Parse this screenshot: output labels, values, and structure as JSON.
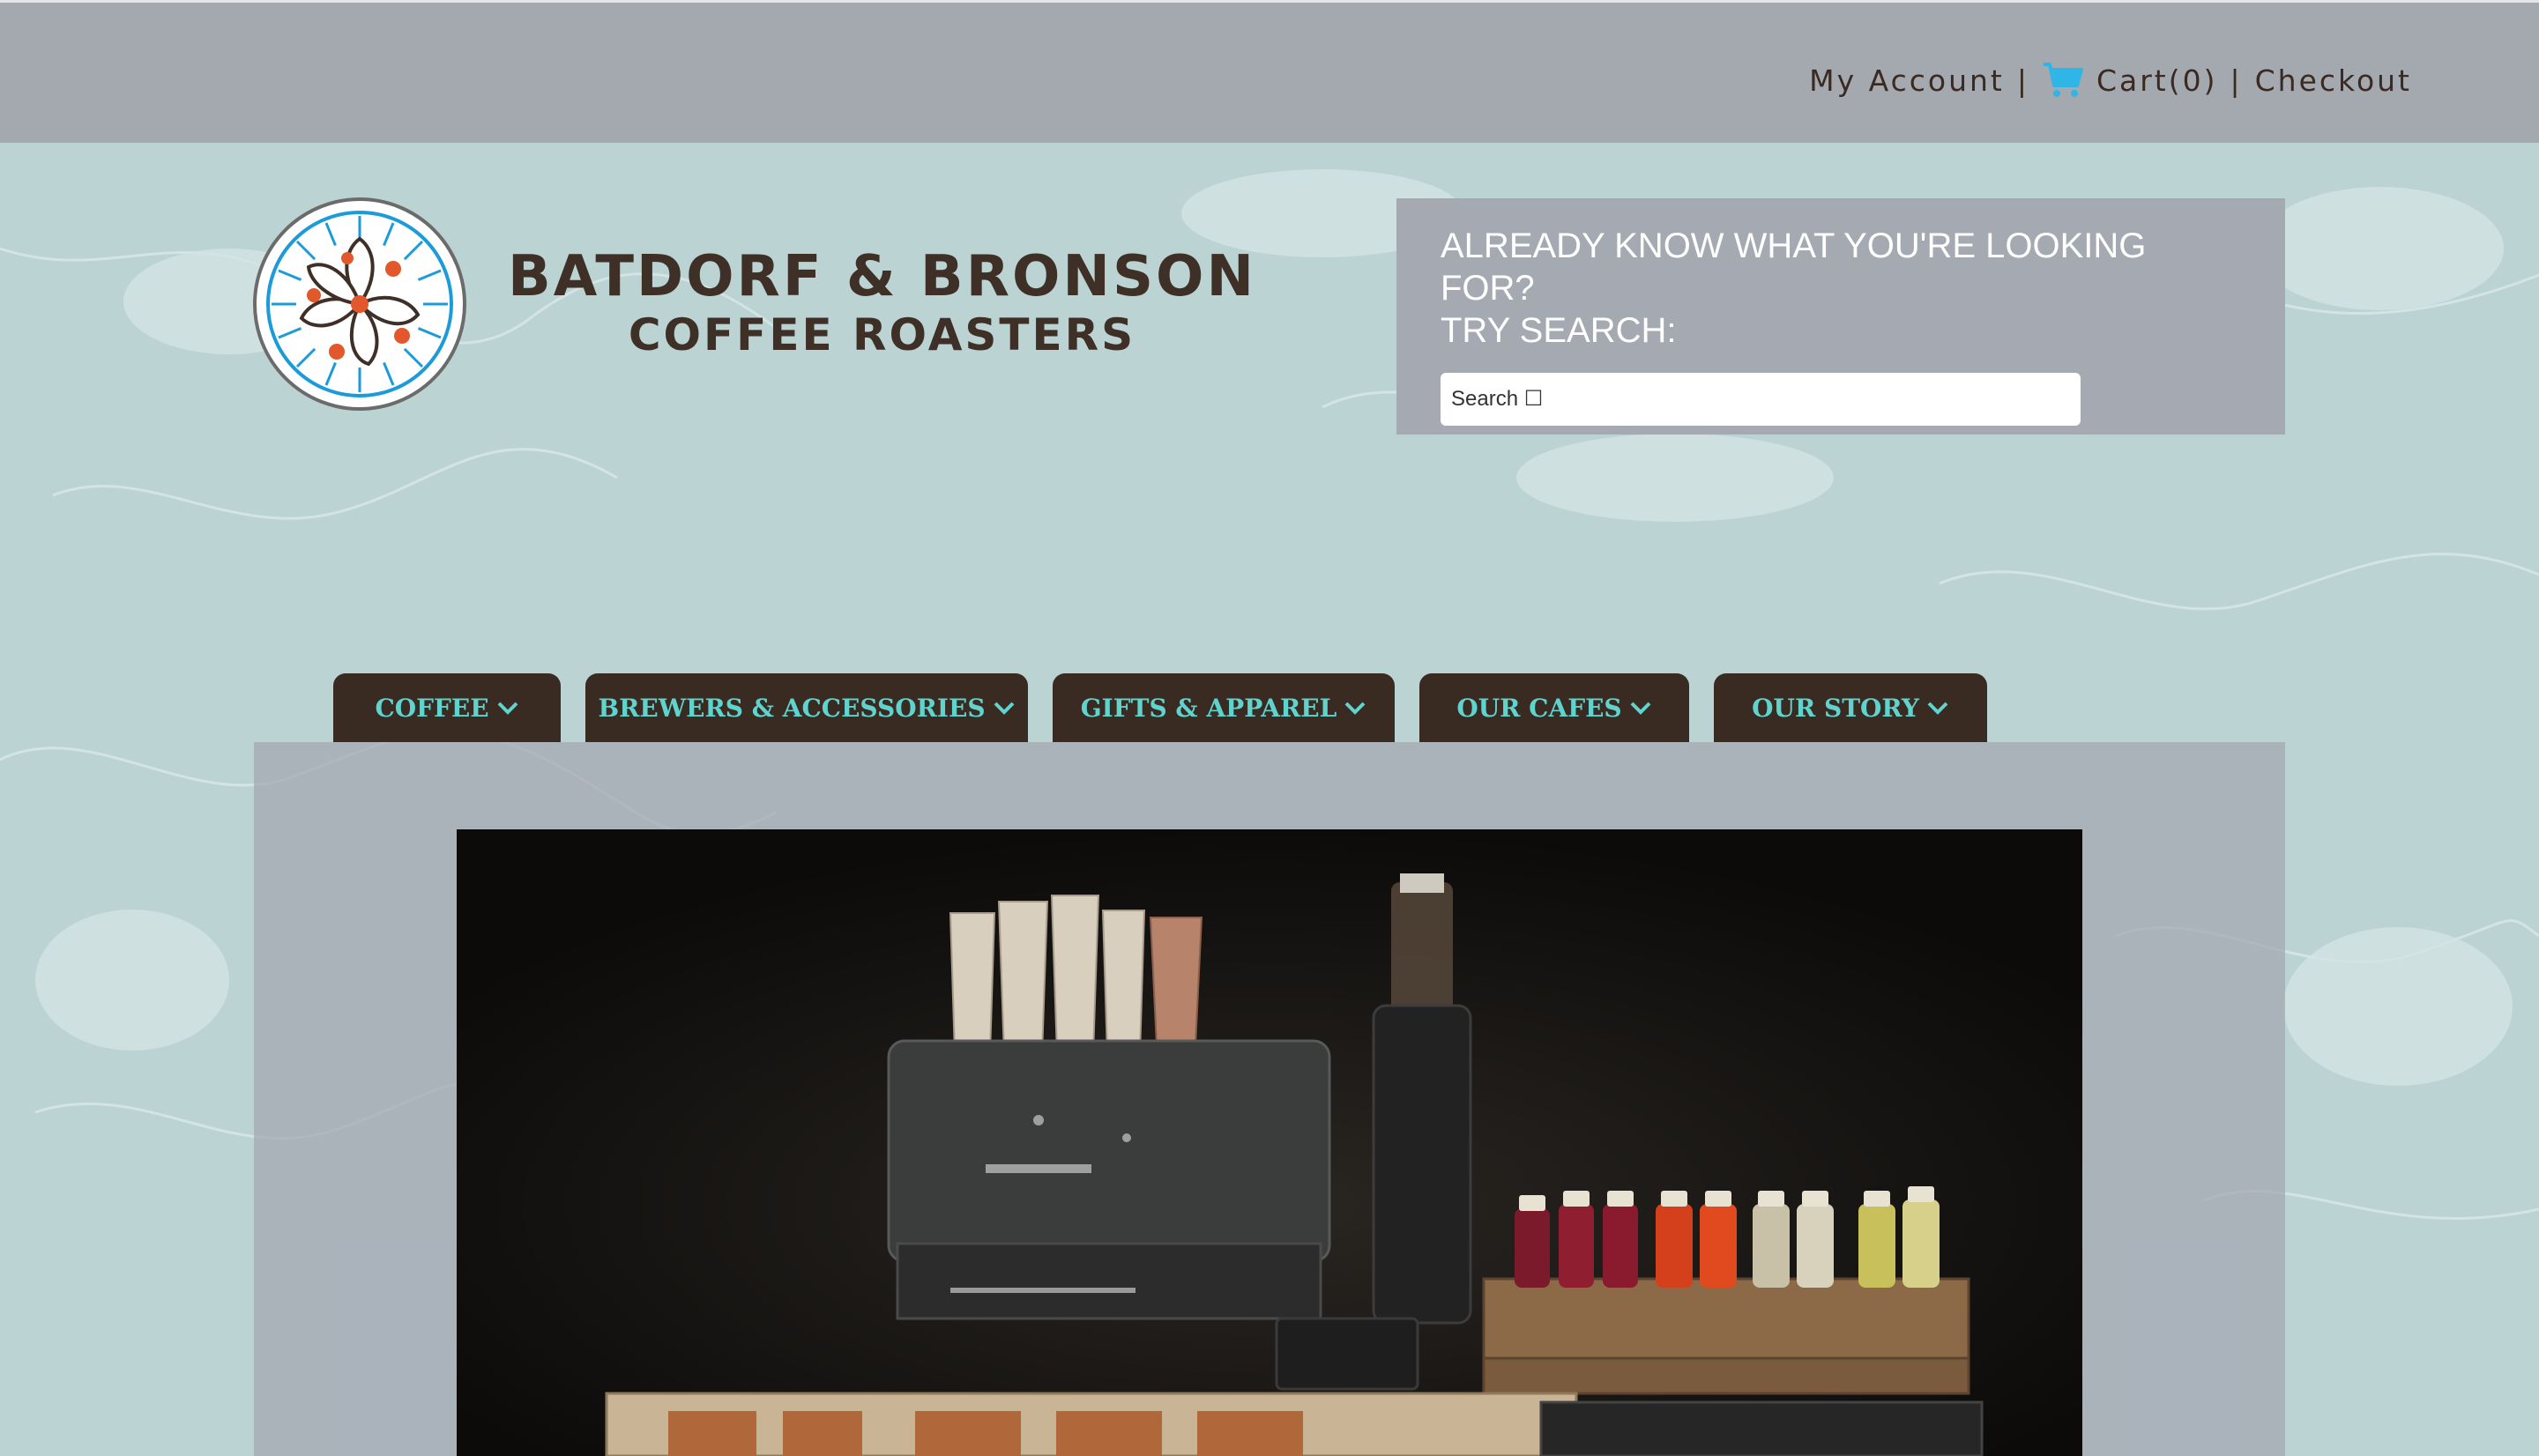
{
  "topbar": {
    "my_account": "My Account",
    "sep1": "|",
    "cart": "Cart(0)",
    "sep2": "|",
    "checkout": "Checkout"
  },
  "logo": {
    "line1": "BATDORF & BRONSON",
    "line2": "COFFEE ROASTERS"
  },
  "search": {
    "heading_line1": "ALREADY KNOW WHAT YOU'RE LOOKING FOR?",
    "heading_line2": "TRY SEARCH:",
    "placeholder": "Search ☐"
  },
  "nav": {
    "items": [
      {
        "label": "COFFEE"
      },
      {
        "label": "BREWERS & ACCESSORIES"
      },
      {
        "label": "GIFTS & APPAREL"
      },
      {
        "label": "OUR CAFES"
      },
      {
        "label": "OUR STORY"
      }
    ]
  },
  "colors": {
    "accent_teal": "#5fd4cf",
    "nav_brown": "#3a2b22",
    "topbar_gray": "#a4a9b0",
    "page_bg": "#bcd3d3"
  },
  "icons": {
    "cart": "shopping-cart-icon",
    "chevron": "chevron-down-icon"
  }
}
